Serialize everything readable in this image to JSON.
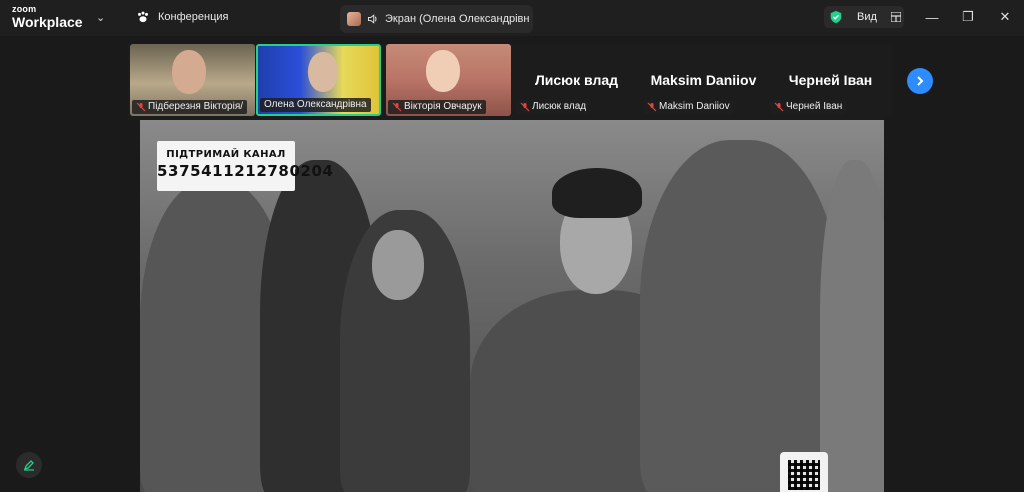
{
  "app": {
    "brand_top": "zoom",
    "brand_bottom": "Workplace"
  },
  "meeting": {
    "title": "Конференция"
  },
  "share": {
    "label": "Экран (Олена Олександрівн"
  },
  "view": {
    "label": "Вид"
  },
  "participants": [
    {
      "name": "Підберезня Вікторія/",
      "video": true
    },
    {
      "name": "Олена Олександрівна",
      "video": true,
      "active": true
    },
    {
      "name": "Вікторія Овчарук",
      "video": true
    },
    {
      "name": "Лисюк влад",
      "display": "Лисюк влад",
      "video": false
    },
    {
      "name": "Maksim Daniiov",
      "display": "Maksim Daniiov",
      "video": false
    },
    {
      "name": "Черней Іван",
      "display": "Черней Іван",
      "video": false
    }
  ],
  "shared_content": {
    "channel_label": "ПІДТРИМАЙ КАНАЛ",
    "channel_number": "5375411212780204"
  },
  "colors": {
    "accent": "#2d8cff",
    "active_border": "#23d18b",
    "shield": "#23d18b",
    "mic_off": "#e0463e"
  },
  "icons": {
    "meeting": "paw-icon",
    "share": "speaker-icon",
    "view": "grid-icon",
    "next": "chevron-right-icon",
    "edit": "pencil-icon"
  }
}
